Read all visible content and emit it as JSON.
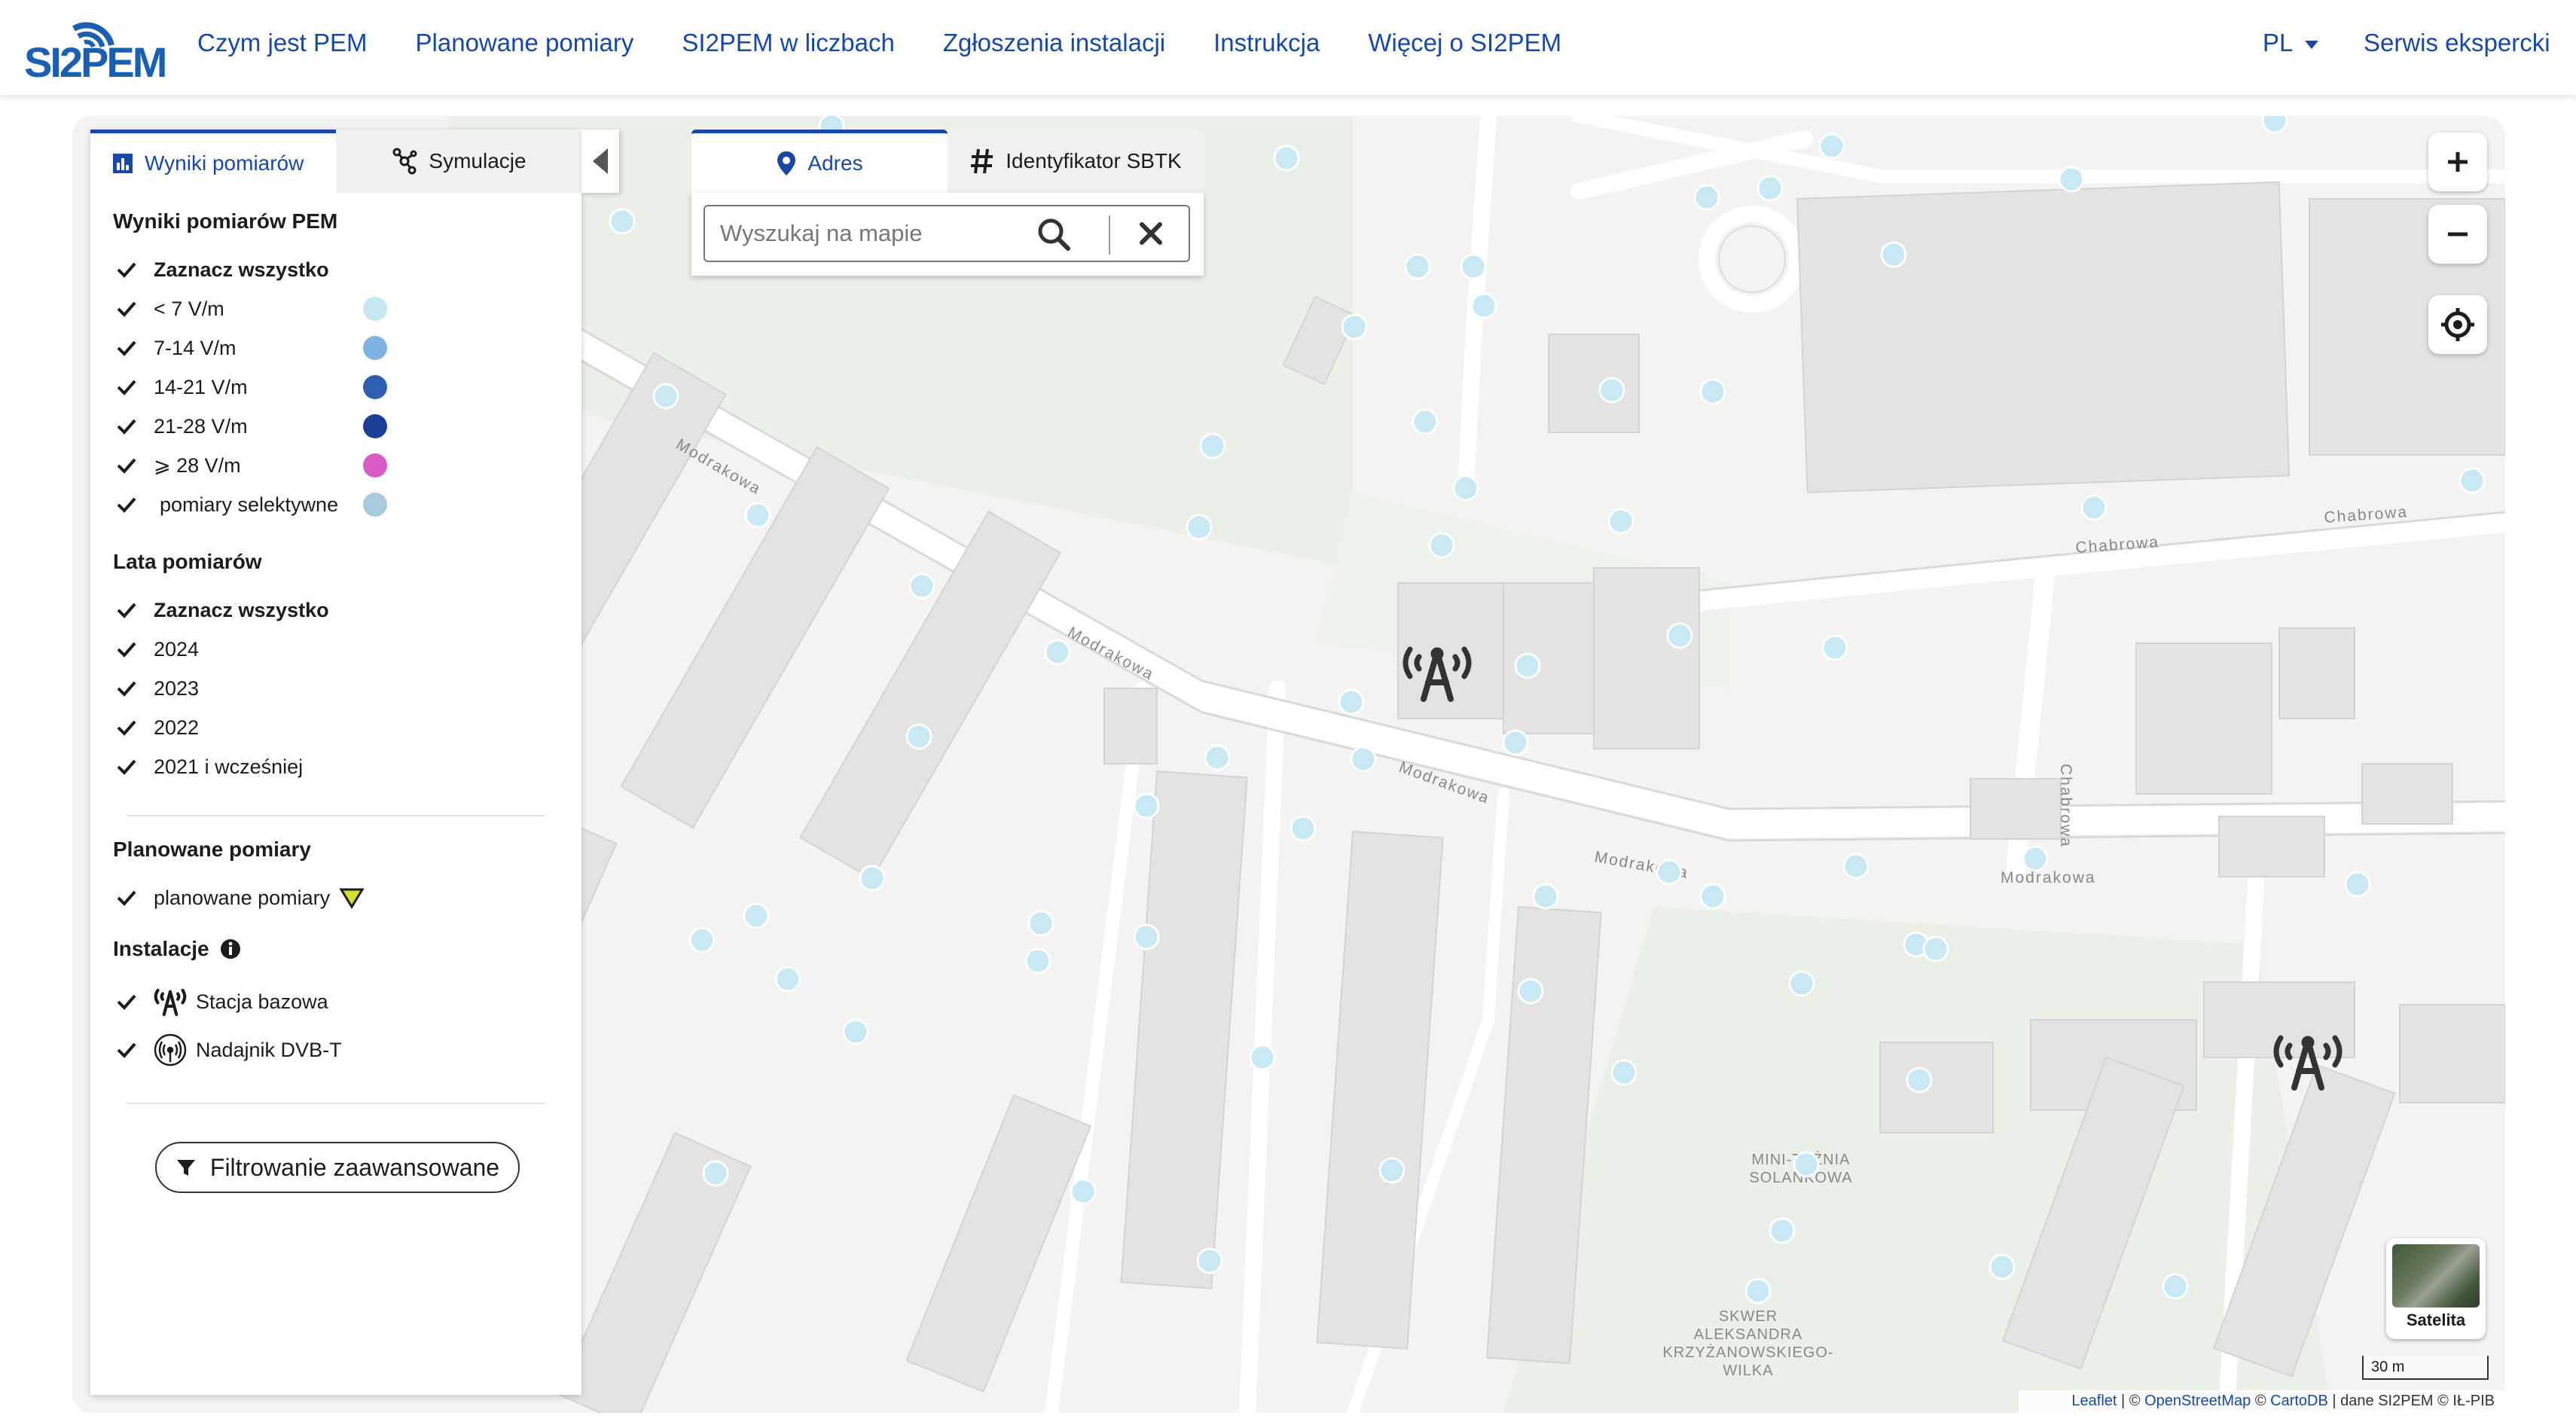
{
  "header": {
    "logo_text": "SI2PEM",
    "nav": [
      "Czym jest PEM",
      "Planowane pomiary",
      "SI2PEM w liczbach",
      "Zgłoszenia instalacji",
      "Instrukcja",
      "Więcej o SI2PEM"
    ],
    "language": "PL",
    "expert_link": "Serwis ekspercki"
  },
  "panel": {
    "tab_results": "Wyniki pomiarów",
    "tab_simulation": "Symulacje",
    "results_title": "Wyniki pomiarów PEM",
    "select_all": "Zaznacz wszystko",
    "ranges": [
      {
        "label": "< 7 V/m",
        "color": "#c6e6f2"
      },
      {
        "label": "7-14 V/m",
        "color": "#7fb4e0"
      },
      {
        "label": "14-21 V/m",
        "color": "#2d5fb0"
      },
      {
        "label": "21-28 V/m",
        "color": "#1b3f96"
      },
      {
        "label": "⩾ 28 V/m",
        "color": "#d95cc6"
      },
      {
        "label": "pomiary selektywne",
        "color": "#a9c9dc"
      }
    ],
    "years_title": "Lata pomiarów",
    "years": [
      "Zaznacz wszystko",
      "2024",
      "2023",
      "2022",
      "2021 i wcześniej"
    ],
    "planned_title": "Planowane pomiary",
    "planned_label": "planowane pomiary",
    "planned_icon_color": "#d4e02a",
    "installations_title": "Instalacje",
    "installations": [
      {
        "label": "Stacja bazowa",
        "icon": "antenna-icon"
      },
      {
        "label": "Nadajnik DVB-T",
        "icon": "broadcast-icon"
      }
    ],
    "filter_button": "Filtrowanie zaawansowane"
  },
  "search": {
    "tab_address": "Adres",
    "tab_sbtk": "Identyfikator SBTK",
    "placeholder": "Wyszukaj na mapie"
  },
  "map": {
    "street_labels": [
      "Modrakowa",
      "Modrakowa",
      "Modrakowa",
      "Modrakowa",
      "Modrakowa",
      "Chabrowa",
      "Chabrowa",
      "Chabrowa"
    ],
    "poi_labels": [
      "MINI-TĘŻNIA",
      "SOLANKOWA",
      "SKWER",
      "ALEKSANDRA",
      "KRZYŻANOWSKIEGO-",
      "WILKA"
    ],
    "measurement_color": "#c8e8f3",
    "satellite_label": "Satelita",
    "scale_label": "30 m",
    "attribution": {
      "leaflet": "Leaflet",
      "osm": "OpenStreetMap",
      "carto": "CartoDB",
      "rest": "| dane SI2PEM © IŁ-PIB"
    }
  }
}
